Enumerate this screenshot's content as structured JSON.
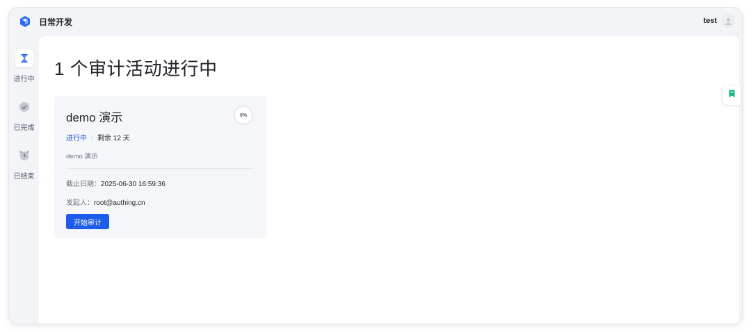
{
  "app": {
    "title": "日常开发",
    "username": "test"
  },
  "sidebar": {
    "items": [
      {
        "label": "进行中",
        "icon": "hourglass-icon",
        "active": true
      },
      {
        "label": "已完成",
        "icon": "check-circle-icon",
        "active": false
      },
      {
        "label": "已结束",
        "icon": "alarm-clock-icon",
        "active": false
      }
    ]
  },
  "main": {
    "title": "1 个审计活动进行中",
    "cards": [
      {
        "title": "demo 演示",
        "progress": "0%",
        "status": "进行中",
        "remaining_prefix": "剩余",
        "remaining_days": "12",
        "remaining_unit": "天",
        "description": "demo 演示",
        "deadline_label": "截止日期：",
        "deadline_value": "2025-06-30 16:59:36",
        "initiator_label": "发起人：",
        "initiator_value": "root@authing.cn",
        "button_label": "开始审计"
      }
    ]
  },
  "colors": {
    "accent": "#1c5ce8",
    "status": "#1d4fd6",
    "floating_icon": "#14b87a"
  }
}
